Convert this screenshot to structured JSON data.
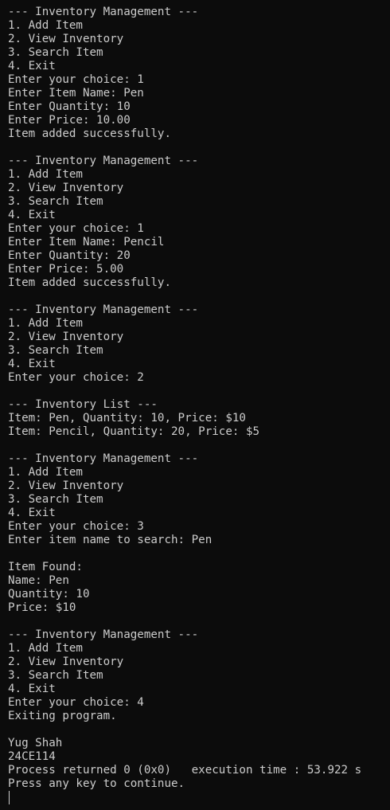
{
  "terminal": {
    "lines": [
      "--- Inventory Management ---",
      "1. Add Item",
      "2. View Inventory",
      "3. Search Item",
      "4. Exit",
      "Enter your choice: 1",
      "Enter Item Name: Pen",
      "Enter Quantity: 10",
      "Enter Price: 10.00",
      "Item added successfully.",
      "",
      "--- Inventory Management ---",
      "1. Add Item",
      "2. View Inventory",
      "3. Search Item",
      "4. Exit",
      "Enter your choice: 1",
      "Enter Item Name: Pencil",
      "Enter Quantity: 20",
      "Enter Price: 5.00",
      "Item added successfully.",
      "",
      "--- Inventory Management ---",
      "1. Add Item",
      "2. View Inventory",
      "3. Search Item",
      "4. Exit",
      "Enter your choice: 2",
      "",
      "--- Inventory List ---",
      "Item: Pen, Quantity: 10, Price: $10",
      "Item: Pencil, Quantity: 20, Price: $5",
      "",
      "--- Inventory Management ---",
      "1. Add Item",
      "2. View Inventory",
      "3. Search Item",
      "4. Exit",
      "Enter your choice: 3",
      "Enter item name to search: Pen",
      "",
      "Item Found:",
      "Name: Pen",
      "Quantity: 10",
      "Price: $10",
      "",
      "--- Inventory Management ---",
      "1. Add Item",
      "2. View Inventory",
      "3. Search Item",
      "4. Exit",
      "Enter your choice: 4",
      "Exiting program.",
      "",
      "Yug Shah",
      "24CE114",
      "Process returned 0 (0x0)   execution time : 53.922 s",
      "Press any key to continue."
    ]
  }
}
